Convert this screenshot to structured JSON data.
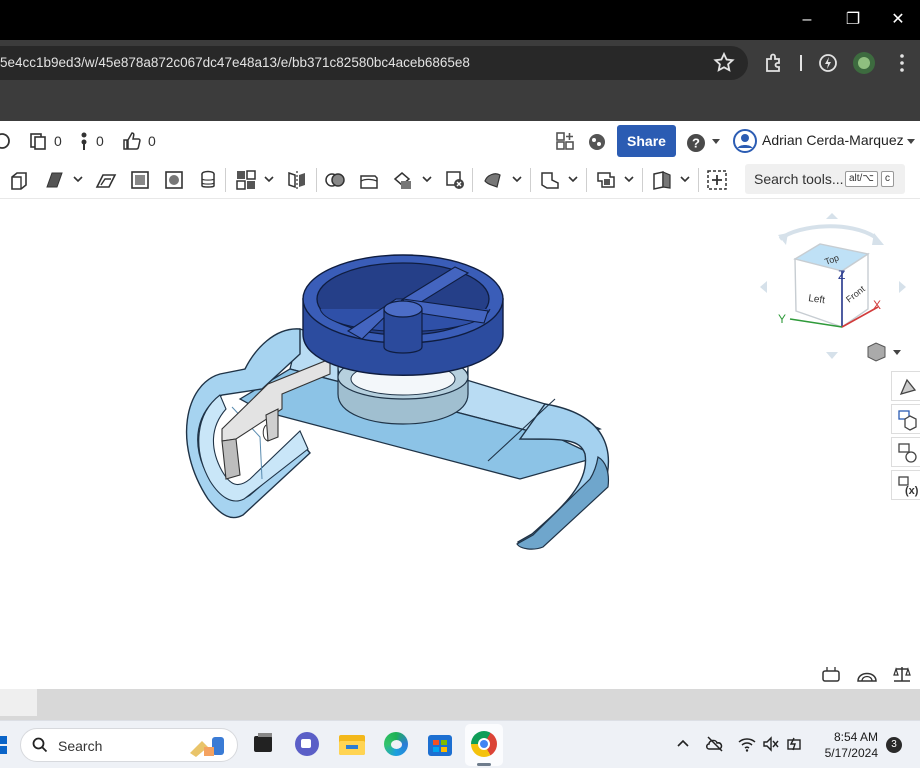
{
  "browser": {
    "url": "5e4cc1b9ed3/w/45e878a872c067dc47e48a13/e/bb371c82580bc4aceb6865e8",
    "window_controls": {
      "minimize": "–",
      "maximize": "❐",
      "close": "✕"
    }
  },
  "header": {
    "counters": [
      {
        "icon": "clipboard-icon",
        "value": "0"
      },
      {
        "icon": "branch-icon",
        "value": "0"
      },
      {
        "icon": "thumbs-up-icon",
        "value": "0"
      }
    ],
    "share_label": "Share",
    "help_label": "?",
    "user_name": "Adrian Cerda-Marquez"
  },
  "toolbar": {
    "search_label": "Search tools...",
    "shortcut_1": "alt/⌥",
    "shortcut_2": "c"
  },
  "viewcube": {
    "top": "Top",
    "front": "Front",
    "left": "Left",
    "axis_x": "X",
    "axis_y": "Y",
    "axis_z": "Z"
  },
  "taskbar": {
    "search_label": "Search",
    "time": "8:54 AM",
    "date": "5/17/2024",
    "notification_count": "3"
  },
  "colors": {
    "share": "#2b5cb3",
    "part_dark_blue": "#2f4d9e",
    "part_light_blue": "#a8d4f0",
    "chrome_bg": "#3c3c3c"
  }
}
